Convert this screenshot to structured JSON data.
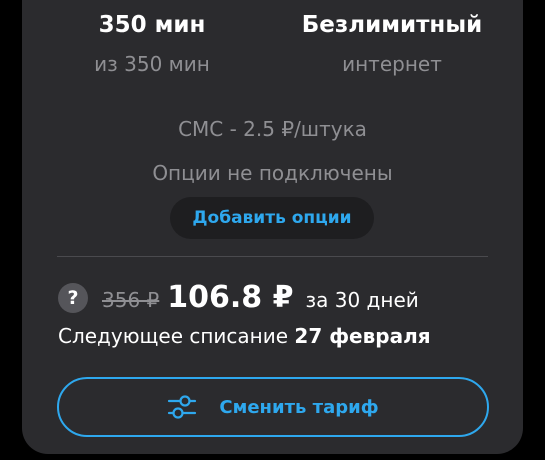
{
  "stats": {
    "minutes": {
      "value": "350 мин",
      "sub": "из 350 мин"
    },
    "internet": {
      "value": "Безлимитный",
      "sub": "интернет"
    }
  },
  "sms": "СМС - 2.5 ₽/штука",
  "options_status": "Опции не подключены",
  "add_options_label": "Добавить опции",
  "price": {
    "help_symbol": "?",
    "old": "356 ₽",
    "new": "106.8 ₽",
    "period": "за 30 дней"
  },
  "next_charge": {
    "prefix": "Следующее списание",
    "date": "27 февраля"
  },
  "change_tariff": {
    "label": "Сменить тариф",
    "icon": "sliders-icon"
  },
  "colors": {
    "accent": "#2ea8ee",
    "card": "#2b2b2e",
    "muted": "#8f8f93"
  }
}
